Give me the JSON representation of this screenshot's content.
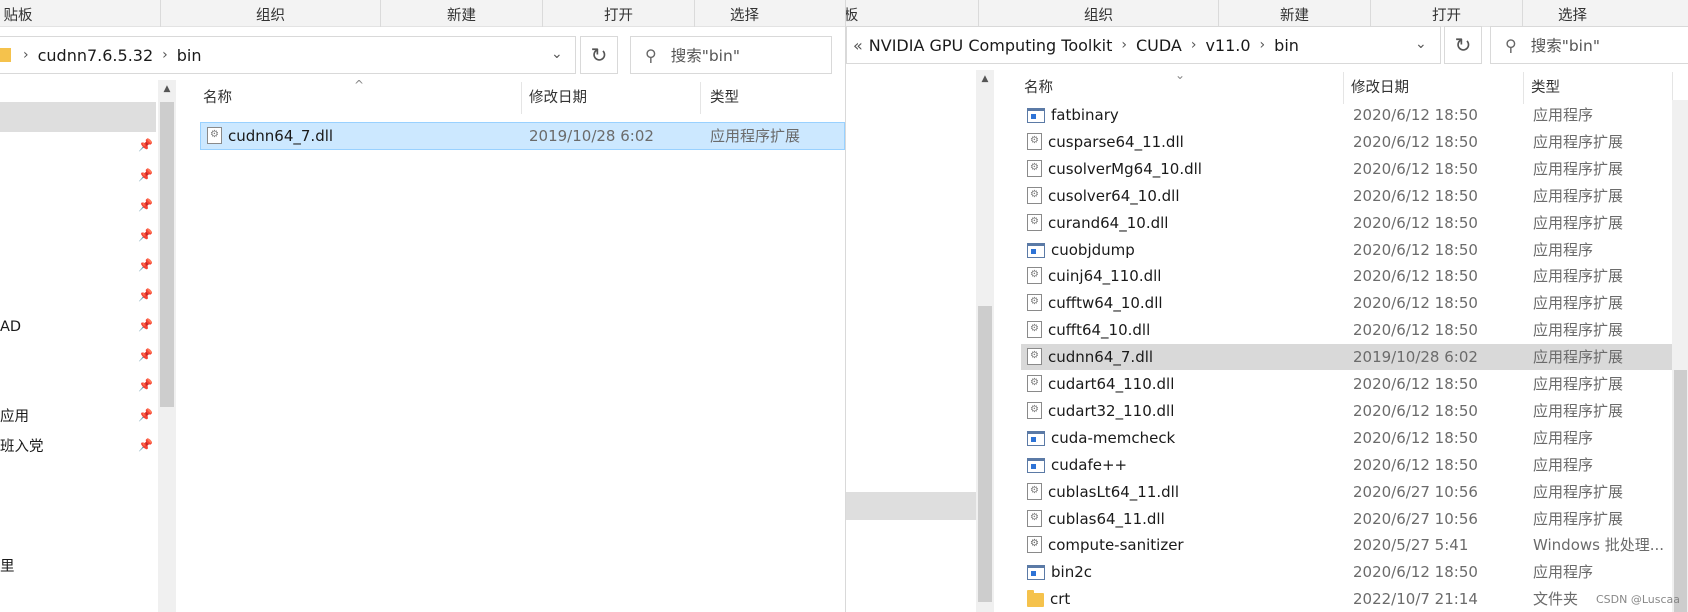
{
  "left": {
    "ribbon": {
      "clip": "贴板",
      "org": "组织",
      "new": "新建",
      "open": "打开",
      "select": "选择"
    },
    "address": {
      "segs": [
        "cudnn7.6.5.32",
        "bin"
      ]
    },
    "search": {
      "placeholder": "搜索\"bin\""
    },
    "nav": {
      "cad": "AD",
      "app": "应用",
      "party": "班入党",
      "last": "里"
    },
    "columns": {
      "name": "名称",
      "date": "修改日期",
      "type": "类型"
    },
    "files": [
      {
        "name": "cudnn64_7.dll",
        "date": "2019/10/28 6:02",
        "type": "应用程序扩展",
        "icon": "dll"
      }
    ]
  },
  "right": {
    "ribbon": {
      "clip": "板",
      "org": "组织",
      "new": "新建",
      "open": "打开",
      "select": "选择"
    },
    "address": {
      "overflow": "«",
      "segs": [
        "NVIDIA GPU Computing Toolkit",
        "CUDA",
        "v11.0",
        "bin"
      ]
    },
    "search": {
      "placeholder": "搜索\"bin\""
    },
    "columns": {
      "name": "名称",
      "date": "修改日期",
      "type": "类型"
    },
    "files": [
      {
        "name": "fatbinary",
        "date": "2020/6/12 18:50",
        "type": "应用程序",
        "icon": "exe"
      },
      {
        "name": "cusparse64_11.dll",
        "date": "2020/6/12 18:50",
        "type": "应用程序扩展",
        "icon": "dll"
      },
      {
        "name": "cusolverMg64_10.dll",
        "date": "2020/6/12 18:50",
        "type": "应用程序扩展",
        "icon": "dll"
      },
      {
        "name": "cusolver64_10.dll",
        "date": "2020/6/12 18:50",
        "type": "应用程序扩展",
        "icon": "dll"
      },
      {
        "name": "curand64_10.dll",
        "date": "2020/6/12 18:50",
        "type": "应用程序扩展",
        "icon": "dll"
      },
      {
        "name": "cuobjdump",
        "date": "2020/6/12 18:50",
        "type": "应用程序",
        "icon": "exe"
      },
      {
        "name": "cuinj64_110.dll",
        "date": "2020/6/12 18:50",
        "type": "应用程序扩展",
        "icon": "dll"
      },
      {
        "name": "cufftw64_10.dll",
        "date": "2020/6/12 18:50",
        "type": "应用程序扩展",
        "icon": "dll"
      },
      {
        "name": "cufft64_10.dll",
        "date": "2020/6/12 18:50",
        "type": "应用程序扩展",
        "icon": "dll"
      },
      {
        "name": "cudnn64_7.dll",
        "date": "2019/10/28 6:02",
        "type": "应用程序扩展",
        "icon": "dll",
        "highlight": true
      },
      {
        "name": "cudart64_110.dll",
        "date": "2020/6/12 18:50",
        "type": "应用程序扩展",
        "icon": "dll"
      },
      {
        "name": "cudart32_110.dll",
        "date": "2020/6/12 18:50",
        "type": "应用程序扩展",
        "icon": "dll"
      },
      {
        "name": "cuda-memcheck",
        "date": "2020/6/12 18:50",
        "type": "应用程序",
        "icon": "exe"
      },
      {
        "name": "cudafe++",
        "date": "2020/6/12 18:50",
        "type": "应用程序",
        "icon": "exe"
      },
      {
        "name": "cublasLt64_11.dll",
        "date": "2020/6/27 10:56",
        "type": "应用程序扩展",
        "icon": "dll"
      },
      {
        "name": "cublas64_11.dll",
        "date": "2020/6/27 10:56",
        "type": "应用程序扩展",
        "icon": "dll"
      },
      {
        "name": "compute-sanitizer",
        "date": "2020/5/27 5:41",
        "type": "Windows 批处理...",
        "icon": "bat"
      },
      {
        "name": "bin2c",
        "date": "2020/6/12 18:50",
        "type": "应用程序",
        "icon": "exe"
      },
      {
        "name": "crt",
        "date": "2022/10/7 21:14",
        "type": "文件夹",
        "icon": "folder"
      }
    ]
  },
  "watermark": "CSDN @Luscaa"
}
